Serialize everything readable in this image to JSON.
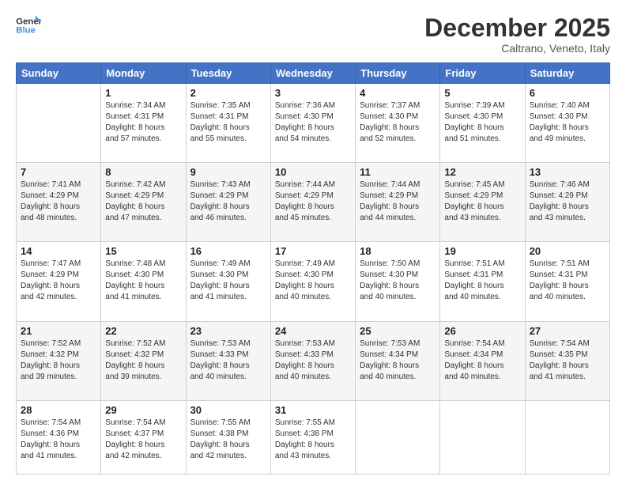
{
  "header": {
    "logo_line1": "General",
    "logo_line2": "Blue",
    "month": "December 2025",
    "location": "Caltrano, Veneto, Italy"
  },
  "days_of_week": [
    "Sunday",
    "Monday",
    "Tuesday",
    "Wednesday",
    "Thursday",
    "Friday",
    "Saturday"
  ],
  "weeks": [
    [
      {
        "day": "",
        "info": ""
      },
      {
        "day": "1",
        "info": "Sunrise: 7:34 AM\nSunset: 4:31 PM\nDaylight: 8 hours\nand 57 minutes."
      },
      {
        "day": "2",
        "info": "Sunrise: 7:35 AM\nSunset: 4:31 PM\nDaylight: 8 hours\nand 55 minutes."
      },
      {
        "day": "3",
        "info": "Sunrise: 7:36 AM\nSunset: 4:30 PM\nDaylight: 8 hours\nand 54 minutes."
      },
      {
        "day": "4",
        "info": "Sunrise: 7:37 AM\nSunset: 4:30 PM\nDaylight: 8 hours\nand 52 minutes."
      },
      {
        "day": "5",
        "info": "Sunrise: 7:39 AM\nSunset: 4:30 PM\nDaylight: 8 hours\nand 51 minutes."
      },
      {
        "day": "6",
        "info": "Sunrise: 7:40 AM\nSunset: 4:30 PM\nDaylight: 8 hours\nand 49 minutes."
      }
    ],
    [
      {
        "day": "7",
        "info": "Sunrise: 7:41 AM\nSunset: 4:29 PM\nDaylight: 8 hours\nand 48 minutes."
      },
      {
        "day": "8",
        "info": "Sunrise: 7:42 AM\nSunset: 4:29 PM\nDaylight: 8 hours\nand 47 minutes."
      },
      {
        "day": "9",
        "info": "Sunrise: 7:43 AM\nSunset: 4:29 PM\nDaylight: 8 hours\nand 46 minutes."
      },
      {
        "day": "10",
        "info": "Sunrise: 7:44 AM\nSunset: 4:29 PM\nDaylight: 8 hours\nand 45 minutes."
      },
      {
        "day": "11",
        "info": "Sunrise: 7:44 AM\nSunset: 4:29 PM\nDaylight: 8 hours\nand 44 minutes."
      },
      {
        "day": "12",
        "info": "Sunrise: 7:45 AM\nSunset: 4:29 PM\nDaylight: 8 hours\nand 43 minutes."
      },
      {
        "day": "13",
        "info": "Sunrise: 7:46 AM\nSunset: 4:29 PM\nDaylight: 8 hours\nand 43 minutes."
      }
    ],
    [
      {
        "day": "14",
        "info": "Sunrise: 7:47 AM\nSunset: 4:29 PM\nDaylight: 8 hours\nand 42 minutes."
      },
      {
        "day": "15",
        "info": "Sunrise: 7:48 AM\nSunset: 4:30 PM\nDaylight: 8 hours\nand 41 minutes."
      },
      {
        "day": "16",
        "info": "Sunrise: 7:49 AM\nSunset: 4:30 PM\nDaylight: 8 hours\nand 41 minutes."
      },
      {
        "day": "17",
        "info": "Sunrise: 7:49 AM\nSunset: 4:30 PM\nDaylight: 8 hours\nand 40 minutes."
      },
      {
        "day": "18",
        "info": "Sunrise: 7:50 AM\nSunset: 4:30 PM\nDaylight: 8 hours\nand 40 minutes."
      },
      {
        "day": "19",
        "info": "Sunrise: 7:51 AM\nSunset: 4:31 PM\nDaylight: 8 hours\nand 40 minutes."
      },
      {
        "day": "20",
        "info": "Sunrise: 7:51 AM\nSunset: 4:31 PM\nDaylight: 8 hours\nand 40 minutes."
      }
    ],
    [
      {
        "day": "21",
        "info": "Sunrise: 7:52 AM\nSunset: 4:32 PM\nDaylight: 8 hours\nand 39 minutes."
      },
      {
        "day": "22",
        "info": "Sunrise: 7:52 AM\nSunset: 4:32 PM\nDaylight: 8 hours\nand 39 minutes."
      },
      {
        "day": "23",
        "info": "Sunrise: 7:53 AM\nSunset: 4:33 PM\nDaylight: 8 hours\nand 40 minutes."
      },
      {
        "day": "24",
        "info": "Sunrise: 7:53 AM\nSunset: 4:33 PM\nDaylight: 8 hours\nand 40 minutes."
      },
      {
        "day": "25",
        "info": "Sunrise: 7:53 AM\nSunset: 4:34 PM\nDaylight: 8 hours\nand 40 minutes."
      },
      {
        "day": "26",
        "info": "Sunrise: 7:54 AM\nSunset: 4:34 PM\nDaylight: 8 hours\nand 40 minutes."
      },
      {
        "day": "27",
        "info": "Sunrise: 7:54 AM\nSunset: 4:35 PM\nDaylight: 8 hours\nand 41 minutes."
      }
    ],
    [
      {
        "day": "28",
        "info": "Sunrise: 7:54 AM\nSunset: 4:36 PM\nDaylight: 8 hours\nand 41 minutes."
      },
      {
        "day": "29",
        "info": "Sunrise: 7:54 AM\nSunset: 4:37 PM\nDaylight: 8 hours\nand 42 minutes."
      },
      {
        "day": "30",
        "info": "Sunrise: 7:55 AM\nSunset: 4:38 PM\nDaylight: 8 hours\nand 42 minutes."
      },
      {
        "day": "31",
        "info": "Sunrise: 7:55 AM\nSunset: 4:38 PM\nDaylight: 8 hours\nand 43 minutes."
      },
      {
        "day": "",
        "info": ""
      },
      {
        "day": "",
        "info": ""
      },
      {
        "day": "",
        "info": ""
      }
    ]
  ]
}
